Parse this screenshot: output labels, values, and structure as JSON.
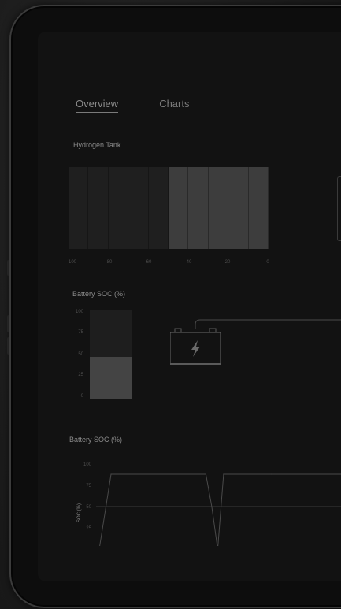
{
  "tabs": [
    {
      "label": "Overview",
      "active": true
    },
    {
      "label": "Charts",
      "active": false
    }
  ],
  "hydrogen_tank": {
    "title": "Hydrogen Tank",
    "fill_percent": 50,
    "axis_ticks": [
      "100",
      "80",
      "60",
      "40",
      "20",
      "0"
    ]
  },
  "battery_gauge": {
    "title": "Battery SOC (%)",
    "value_percent": 47,
    "axis_ticks": [
      "100",
      "75",
      "50",
      "25",
      "0"
    ]
  },
  "battery_icon": "battery-bolt-icon",
  "colors": {
    "background": "#121212",
    "fill": "#444444",
    "line": "#4a4a4a"
  },
  "chart_data": {
    "type": "line",
    "title": "Battery SOC (%)",
    "ylabel": "SOC (%)",
    "xlabel": "",
    "ylim": [
      0,
      100
    ],
    "yticks": [
      "100",
      "75",
      "50",
      "25",
      "0"
    ],
    "x": [
      0,
      4,
      36,
      38,
      40,
      42,
      58,
      85,
      87,
      89,
      91,
      100
    ],
    "series": [
      {
        "values": [
          0,
          88,
          88,
          50,
          0,
          88,
          88,
          88,
          50,
          0,
          88,
          88
        ]
      }
    ],
    "reference_line": 50,
    "grid": false
  }
}
